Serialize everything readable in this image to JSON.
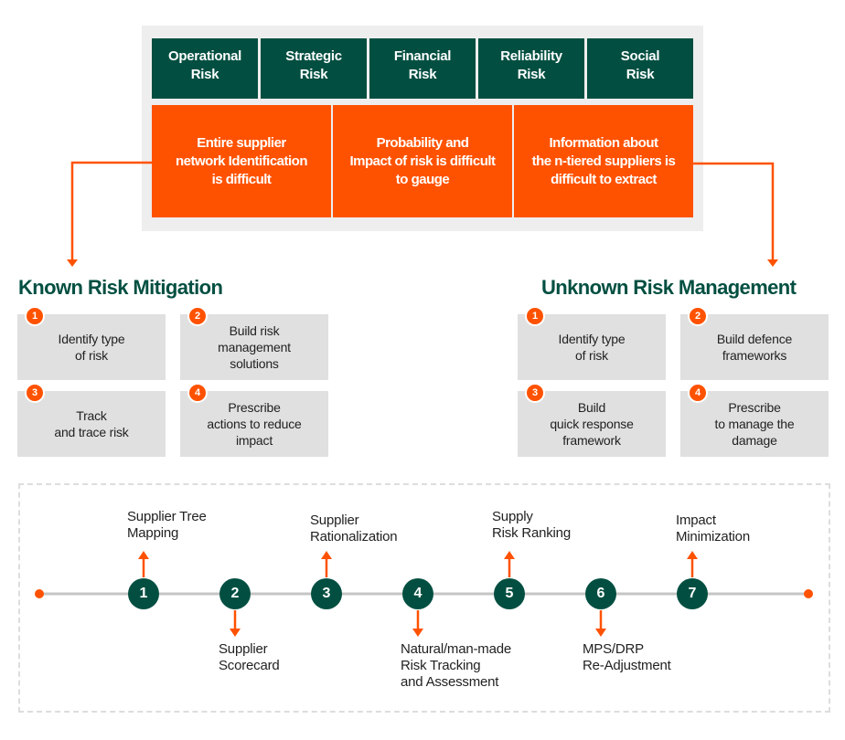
{
  "colors": {
    "primary_green": "#024F41",
    "accent_orange": "#FF5200",
    "panel_grey": "#EEEEEE",
    "card_grey": "#E0E0E0"
  },
  "risk_types": [
    {
      "lines": [
        "Operational",
        "Risk"
      ]
    },
    {
      "lines": [
        "Strategic",
        "Risk"
      ]
    },
    {
      "lines": [
        "Financial",
        "Risk"
      ]
    },
    {
      "lines": [
        "Reliability",
        "Risk"
      ]
    },
    {
      "lines": [
        "Social",
        "Risk"
      ]
    }
  ],
  "challenges": [
    {
      "lines": [
        "Entire supplier",
        "network Identification",
        "is difficult"
      ]
    },
    {
      "lines": [
        "Probability and",
        "Impact of risk is difficult",
        "to gauge"
      ]
    },
    {
      "lines": [
        "Information about",
        "the n-tiered suppliers is",
        "difficult to extract"
      ]
    }
  ],
  "known": {
    "title": "Known Risk Mitigation",
    "steps": [
      {
        "num": "1",
        "lines": [
          "Identify type",
          "of risk"
        ]
      },
      {
        "num": "2",
        "lines": [
          "Build risk",
          "management",
          "solutions"
        ]
      },
      {
        "num": "3",
        "lines": [
          "Track",
          "and trace risk"
        ]
      },
      {
        "num": "4",
        "lines": [
          "Prescribe",
          "actions to reduce",
          "impact"
        ]
      }
    ]
  },
  "unknown": {
    "title": "Unknown Risk Management",
    "steps": [
      {
        "num": "1",
        "lines": [
          "Identify type",
          "of risk"
        ]
      },
      {
        "num": "2",
        "lines": [
          "Build defence",
          "frameworks"
        ]
      },
      {
        "num": "3",
        "lines": [
          "Build",
          "quick response",
          "framework"
        ]
      },
      {
        "num": "4",
        "lines": [
          "Prescribe",
          "to manage the",
          "damage"
        ]
      }
    ]
  },
  "timeline": {
    "steps": [
      {
        "num": "1",
        "direction": "up",
        "lines": [
          "Supplier Tree",
          "Mapping"
        ]
      },
      {
        "num": "2",
        "direction": "down",
        "lines": [
          "Supplier",
          "Scorecard"
        ]
      },
      {
        "num": "3",
        "direction": "up",
        "lines": [
          "Supplier",
          "Rationalization"
        ]
      },
      {
        "num": "4",
        "direction": "down",
        "lines": [
          "Natural/man-made",
          "Risk Tracking",
          "and Assessment"
        ]
      },
      {
        "num": "5",
        "direction": "up",
        "lines": [
          "Supply",
          "Risk Ranking"
        ]
      },
      {
        "num": "6",
        "direction": "down",
        "lines": [
          "MPS/DRP",
          "Re-Adjustment"
        ]
      },
      {
        "num": "7",
        "direction": "up",
        "lines": [
          "Impact",
          "Minimization"
        ]
      }
    ]
  }
}
